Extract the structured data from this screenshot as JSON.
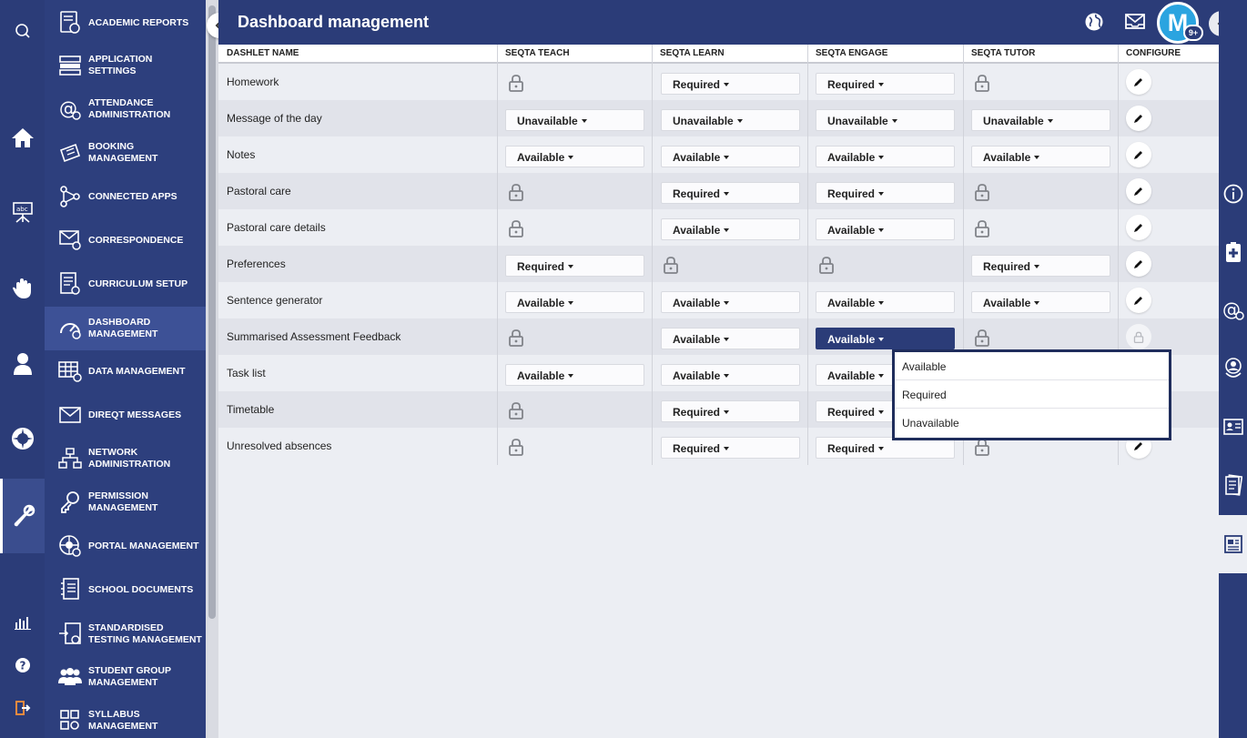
{
  "page": {
    "title": "Dashboard management",
    "notification_badge": "9+",
    "avatar_letter": "M"
  },
  "sidebar": {
    "items": [
      {
        "label": "ACADEMIC REPORTS",
        "icon": "academic-reports-icon"
      },
      {
        "label": "APPLICATION SETTINGS",
        "icon": "application-settings-icon"
      },
      {
        "label": "ATTENDANCE ADMINISTRATION",
        "icon": "attendance-icon"
      },
      {
        "label": "BOOKING MANAGEMENT",
        "icon": "booking-icon"
      },
      {
        "label": "CONNECTED APPS",
        "icon": "connected-apps-icon"
      },
      {
        "label": "CORRESPONDENCE",
        "icon": "correspondence-icon"
      },
      {
        "label": "CURRICULUM SETUP",
        "icon": "curriculum-icon"
      },
      {
        "label": "DASHBOARD MANAGEMENT",
        "icon": "dashboard-icon",
        "selected": true
      },
      {
        "label": "DATA MANAGEMENT",
        "icon": "data-management-icon"
      },
      {
        "label": "DIREQT MESSAGES",
        "icon": "direqt-messages-icon"
      },
      {
        "label": "NETWORK ADMINISTRATION",
        "icon": "network-icon"
      },
      {
        "label": "PERMISSION MANAGEMENT",
        "icon": "permission-key-icon"
      },
      {
        "label": "PORTAL MANAGEMENT",
        "icon": "portal-icon"
      },
      {
        "label": "SCHOOL DOCUMENTS",
        "icon": "school-documents-icon"
      },
      {
        "label": "STANDARDISED TESTING MANAGEMENT",
        "icon": "testing-icon"
      },
      {
        "label": "STUDENT GROUP MANAGEMENT",
        "icon": "student-group-icon"
      },
      {
        "label": "SYLLABUS MANAGEMENT",
        "icon": "syllabus-icon"
      }
    ]
  },
  "table": {
    "headers": [
      "DASHLET NAME",
      "SEQTA TEACH",
      "SEQTA LEARN",
      "SEQTA ENGAGE",
      "SEQTA TUTOR",
      "CONFIGURE"
    ],
    "rows": [
      {
        "name": "Homework",
        "cells": [
          null,
          "Required",
          "Required",
          null
        ]
      },
      {
        "name": "Message of the day",
        "cells": [
          "Unavailable",
          "Unavailable",
          "Unavailable",
          "Unavailable"
        ]
      },
      {
        "name": "Notes",
        "cells": [
          "Available",
          "Available",
          "Available",
          "Available"
        ]
      },
      {
        "name": "Pastoral care",
        "cells": [
          null,
          "Required",
          "Required",
          null
        ]
      },
      {
        "name": "Pastoral care details",
        "cells": [
          null,
          "Available",
          "Available",
          null
        ]
      },
      {
        "name": "Preferences",
        "cells": [
          "Required",
          null,
          null,
          "Required"
        ]
      },
      {
        "name": "Sentence generator",
        "cells": [
          "Available",
          "Available",
          "Available",
          "Available"
        ]
      },
      {
        "name": "Summarised Assessment Feedback",
        "cells": [
          null,
          "Available",
          "Available",
          null
        ]
      },
      {
        "name": "Task list",
        "cells": [
          "Available",
          "Available",
          "Available",
          null
        ]
      },
      {
        "name": "Timetable",
        "cells": [
          null,
          "Required",
          "Required",
          null
        ]
      },
      {
        "name": "Unresolved absences",
        "cells": [
          null,
          "Required",
          "Required",
          null
        ]
      }
    ]
  },
  "dropdown_menu": {
    "options": [
      "Available",
      "Required",
      "Unavailable"
    ]
  }
}
